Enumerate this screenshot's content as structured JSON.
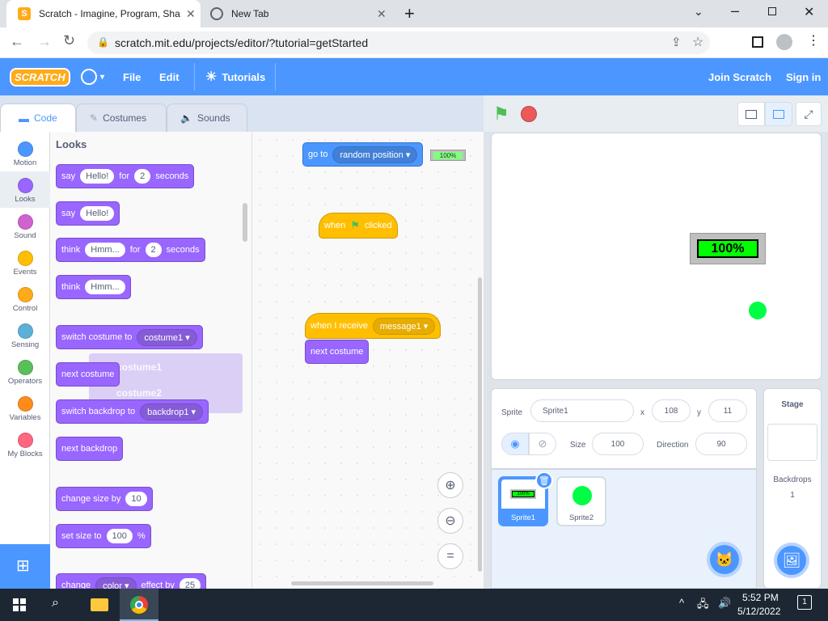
{
  "browser": {
    "tabs": [
      {
        "title": "Scratch - Imagine, Program, Sha"
      },
      {
        "title": "New Tab"
      }
    ],
    "url": "scratch.mit.edu/projects/editor/?tutorial=getStarted"
  },
  "menubar": {
    "logo": "SCRATCH",
    "file": "File",
    "edit": "Edit",
    "tutorials": "Tutorials",
    "join": "Join Scratch",
    "signin": "Sign in"
  },
  "editor_tabs": {
    "code": "Code",
    "costumes": "Costumes",
    "sounds": "Sounds"
  },
  "categories": [
    {
      "label": "Motion",
      "color": "#4c97ff"
    },
    {
      "label": "Looks",
      "color": "#9966ff"
    },
    {
      "label": "Sound",
      "color": "#cf63cf"
    },
    {
      "label": "Events",
      "color": "#ffbf00"
    },
    {
      "label": "Control",
      "color": "#ffab19"
    },
    {
      "label": "Sensing",
      "color": "#5cb1d6"
    },
    {
      "label": "Operators",
      "color": "#59c059"
    },
    {
      "label": "Variables",
      "color": "#ff8c1a"
    },
    {
      "label": "My Blocks",
      "color": "#ff6680"
    }
  ],
  "palette": {
    "heading": "Looks",
    "say_for": {
      "say": "say",
      "msg": "Hello!",
      "for": "for",
      "num": "2",
      "seconds": "seconds"
    },
    "say": {
      "say": "say",
      "msg": "Hello!"
    },
    "think_for": {
      "think": "think",
      "msg": "Hmm...",
      "for": "for",
      "num": "2",
      "seconds": "seconds"
    },
    "think": {
      "think": "think",
      "msg": "Hmm..."
    },
    "switch_costume": {
      "label": "switch costume to",
      "value": "costume1"
    },
    "next_costume": "next costume",
    "switch_backdrop": {
      "label": "switch backdrop to",
      "value": "backdrop1"
    },
    "next_backdrop": "next backdrop",
    "change_size": {
      "label": "change size by",
      "value": "10"
    },
    "set_size": {
      "label": "set size to",
      "value": "100",
      "unit": "%"
    },
    "change_effect": {
      "label": "change",
      "effect": "color",
      "by": "effect by",
      "value": "25"
    },
    "dropdown_menu": {
      "option1": "costume1",
      "option2": "costume2"
    }
  },
  "workspace": {
    "goto": {
      "label": "go to",
      "value": "random position",
      "preview": "100%"
    },
    "when_flag": {
      "when": "when",
      "clicked": "clicked"
    },
    "when_receive": {
      "label": "when I receive",
      "value": "message1"
    },
    "next_costume": "next costume"
  },
  "stage": {
    "display_text": "100%"
  },
  "sprite_info": {
    "sprite_label": "Sprite",
    "sprite_name": "Sprite1",
    "x_label": "x",
    "x": "108",
    "y_label": "y",
    "y": "11",
    "size_label": "Size",
    "size": "100",
    "direction_label": "Direction",
    "direction": "90"
  },
  "sprites": [
    {
      "name": "Sprite1",
      "thumb": "100%"
    },
    {
      "name": "Sprite2"
    }
  ],
  "stage_panel": {
    "title": "Stage",
    "backdrops_label": "Backdrops",
    "backdrops_count": "1"
  },
  "taskbar": {
    "time": "5:52 PM",
    "date": "5/12/2022"
  }
}
